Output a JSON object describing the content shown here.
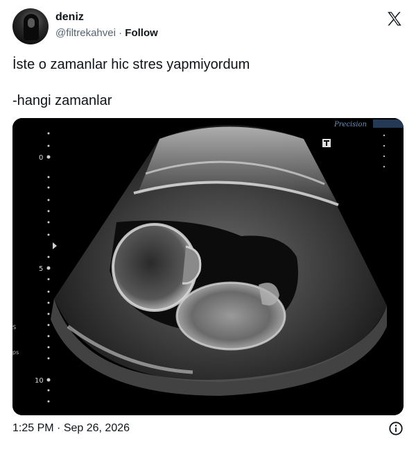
{
  "author": {
    "display_name": "deniz",
    "handle": "@filtrekahvei",
    "separator": "·",
    "follow_label": "Follow"
  },
  "tweet": {
    "lines": [
      "İste o zamanlar hic stres yapmiyordum",
      "-hangi zamanlar"
    ]
  },
  "media": {
    "brand_label": "Precision",
    "depth_labels": [
      "0",
      "5",
      "10"
    ],
    "side_labels": [
      "S",
      "ps"
    ]
  },
  "footer": {
    "time": "1:25 PM",
    "separator": "·",
    "date": "Sep 26, 2026"
  },
  "icons": {
    "x_logo": "x-logo-icon",
    "info": "info-icon"
  }
}
